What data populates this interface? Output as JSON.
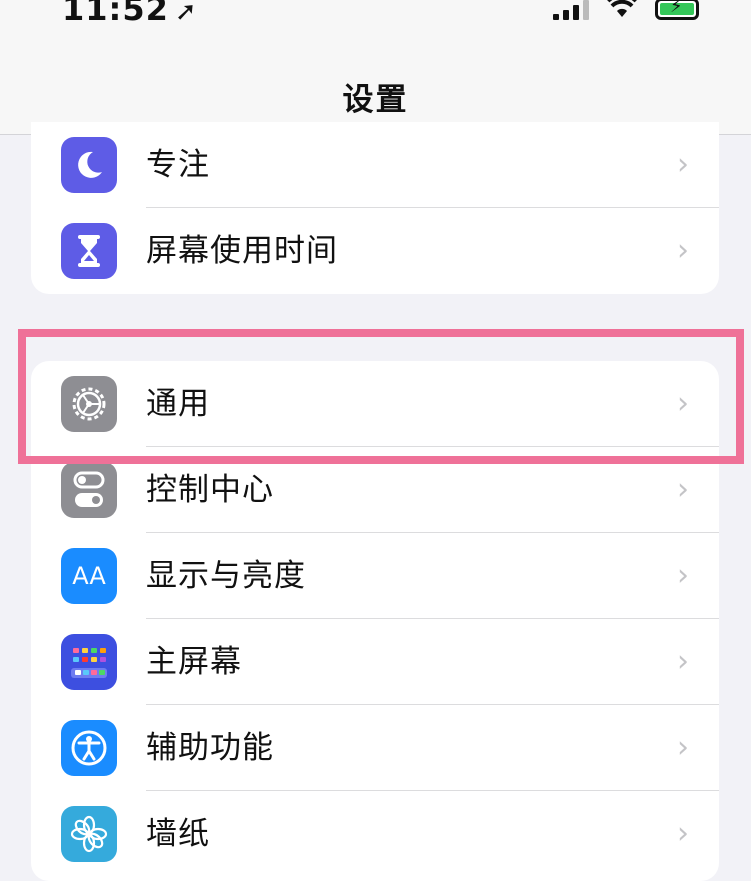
{
  "status_bar": {
    "time": "11:52",
    "location_arrow": "➚"
  },
  "nav": {
    "title": "设置"
  },
  "group1": [
    {
      "label": "专注",
      "icon": "moon-icon",
      "color": "#5e5ce6"
    },
    {
      "label": "屏幕使用时间",
      "icon": "hourglass-icon",
      "color": "#5e5ce6"
    }
  ],
  "group2": [
    {
      "label": "通用",
      "icon": "gear-icon",
      "color": "#8e8e93"
    },
    {
      "label": "控制中心",
      "icon": "toggles-icon",
      "color": "#8e8e93"
    },
    {
      "label": "显示与亮度",
      "icon": "text-size-icon",
      "icon_text": "AA",
      "color": "#1a8cff"
    },
    {
      "label": "主屏幕",
      "icon": "home-screen-icon",
      "color": "#3d4fe0"
    },
    {
      "label": "辅助功能",
      "icon": "accessibility-icon",
      "color": "#1a8cff"
    },
    {
      "label": "墙纸",
      "icon": "flower-icon",
      "color": "#35aadc"
    }
  ],
  "chevron": "›",
  "accent": {
    "highlight": "#ef7198",
    "battery": "#34c759"
  }
}
